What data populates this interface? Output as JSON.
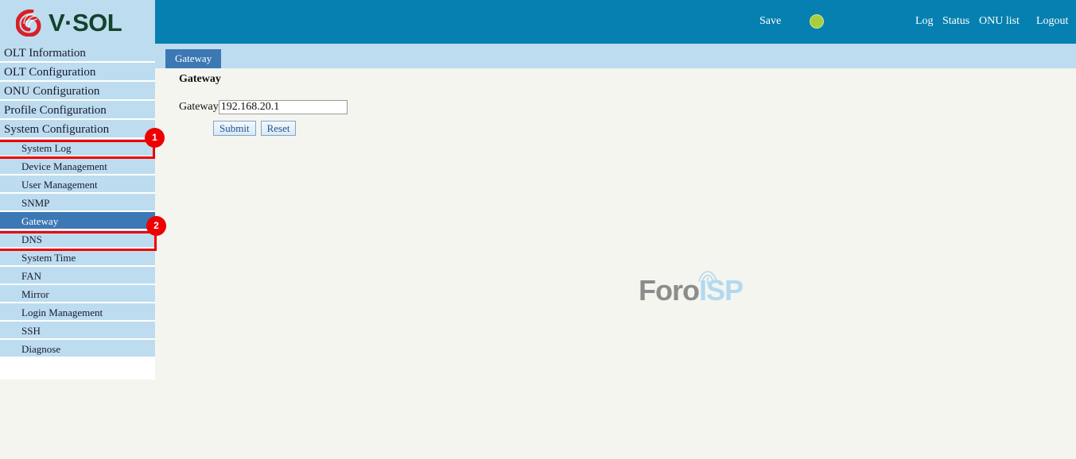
{
  "header": {
    "logo_text": "V·SOL",
    "logo_icon": "vsol-swirl-logo",
    "save_label": "Save",
    "status_led": {
      "icon": "status-led-indicator",
      "color": "#a9ce3c"
    },
    "links": [
      {
        "label": "Log",
        "icon": "log-link"
      },
      {
        "label": "Status",
        "icon": "status-link"
      },
      {
        "label": "ONU list",
        "icon": "onu-list-link"
      },
      {
        "label": "Logout",
        "icon": "logout-link"
      }
    ],
    "background_color": "#0580b0"
  },
  "sidebar": {
    "background_color": "#bddcef",
    "selected_color": "#3c78b4",
    "items": [
      {
        "label": "OLT Information",
        "level": "top",
        "selected": false
      },
      {
        "label": "OLT Configuration",
        "level": "top",
        "selected": false
      },
      {
        "label": "ONU Configuration",
        "level": "top",
        "selected": false
      },
      {
        "label": "Profile Configuration",
        "level": "top",
        "selected": false
      },
      {
        "label": "System Configuration",
        "level": "top",
        "selected": false
      },
      {
        "label": "System Log",
        "level": "sub",
        "selected": false
      },
      {
        "label": "Device Management",
        "level": "sub",
        "selected": false
      },
      {
        "label": "User Management",
        "level": "sub",
        "selected": false
      },
      {
        "label": "SNMP",
        "level": "sub",
        "selected": false
      },
      {
        "label": "Gateway",
        "level": "sub",
        "selected": true
      },
      {
        "label": "DNS",
        "level": "sub",
        "selected": false
      },
      {
        "label": "System Time",
        "level": "sub",
        "selected": false
      },
      {
        "label": "FAN",
        "level": "sub",
        "selected": false
      },
      {
        "label": "Mirror",
        "level": "sub",
        "selected": false
      },
      {
        "label": "Login Management",
        "level": "sub",
        "selected": false
      },
      {
        "label": "SSH",
        "level": "sub",
        "selected": false
      },
      {
        "label": "Diagnose",
        "level": "sub",
        "selected": false
      }
    ]
  },
  "tabs": [
    {
      "label": "Gateway",
      "active": true
    }
  ],
  "main": {
    "panel_title": "Gateway",
    "form": {
      "gateway_label": "Gateway",
      "gateway_value": "192.168.20.1",
      "gateway_placeholder": "",
      "submit_label": "Submit",
      "reset_label": "Reset"
    }
  },
  "watermark": {
    "text_primary": "Foro",
    "text_secondary": "ISP",
    "icon": "antenna-tower-icon",
    "color_primary": "#8c8c8c",
    "color_secondary": "#b3d9f0"
  },
  "annotations": [
    {
      "badge": "1",
      "target": "System Configuration",
      "color": "#ee0000"
    },
    {
      "badge": "2",
      "target": "Gateway",
      "color": "#ee0000"
    }
  ]
}
